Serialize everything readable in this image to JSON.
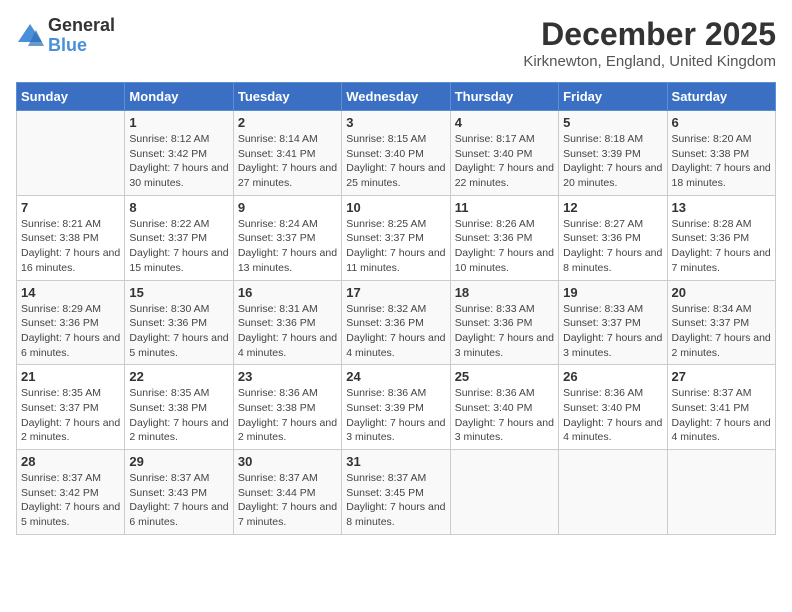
{
  "logo": {
    "general": "General",
    "blue": "Blue"
  },
  "title": "December 2025",
  "location": "Kirknewton, England, United Kingdom",
  "days_of_week": [
    "Sunday",
    "Monday",
    "Tuesday",
    "Wednesday",
    "Thursday",
    "Friday",
    "Saturday"
  ],
  "weeks": [
    [
      {
        "day": "",
        "info": ""
      },
      {
        "day": "1",
        "info": "Sunrise: 8:12 AM\nSunset: 3:42 PM\nDaylight: 7 hours\nand 30 minutes."
      },
      {
        "day": "2",
        "info": "Sunrise: 8:14 AM\nSunset: 3:41 PM\nDaylight: 7 hours\nand 27 minutes."
      },
      {
        "day": "3",
        "info": "Sunrise: 8:15 AM\nSunset: 3:40 PM\nDaylight: 7 hours\nand 25 minutes."
      },
      {
        "day": "4",
        "info": "Sunrise: 8:17 AM\nSunset: 3:40 PM\nDaylight: 7 hours\nand 22 minutes."
      },
      {
        "day": "5",
        "info": "Sunrise: 8:18 AM\nSunset: 3:39 PM\nDaylight: 7 hours\nand 20 minutes."
      },
      {
        "day": "6",
        "info": "Sunrise: 8:20 AM\nSunset: 3:38 PM\nDaylight: 7 hours\nand 18 minutes."
      }
    ],
    [
      {
        "day": "7",
        "info": "Sunrise: 8:21 AM\nSunset: 3:38 PM\nDaylight: 7 hours\nand 16 minutes."
      },
      {
        "day": "8",
        "info": "Sunrise: 8:22 AM\nSunset: 3:37 PM\nDaylight: 7 hours\nand 15 minutes."
      },
      {
        "day": "9",
        "info": "Sunrise: 8:24 AM\nSunset: 3:37 PM\nDaylight: 7 hours\nand 13 minutes."
      },
      {
        "day": "10",
        "info": "Sunrise: 8:25 AM\nSunset: 3:37 PM\nDaylight: 7 hours\nand 11 minutes."
      },
      {
        "day": "11",
        "info": "Sunrise: 8:26 AM\nSunset: 3:36 PM\nDaylight: 7 hours\nand 10 minutes."
      },
      {
        "day": "12",
        "info": "Sunrise: 8:27 AM\nSunset: 3:36 PM\nDaylight: 7 hours\nand 8 minutes."
      },
      {
        "day": "13",
        "info": "Sunrise: 8:28 AM\nSunset: 3:36 PM\nDaylight: 7 hours\nand 7 minutes."
      }
    ],
    [
      {
        "day": "14",
        "info": "Sunrise: 8:29 AM\nSunset: 3:36 PM\nDaylight: 7 hours\nand 6 minutes."
      },
      {
        "day": "15",
        "info": "Sunrise: 8:30 AM\nSunset: 3:36 PM\nDaylight: 7 hours\nand 5 minutes."
      },
      {
        "day": "16",
        "info": "Sunrise: 8:31 AM\nSunset: 3:36 PM\nDaylight: 7 hours\nand 4 minutes."
      },
      {
        "day": "17",
        "info": "Sunrise: 8:32 AM\nSunset: 3:36 PM\nDaylight: 7 hours\nand 4 minutes."
      },
      {
        "day": "18",
        "info": "Sunrise: 8:33 AM\nSunset: 3:36 PM\nDaylight: 7 hours\nand 3 minutes."
      },
      {
        "day": "19",
        "info": "Sunrise: 8:33 AM\nSunset: 3:37 PM\nDaylight: 7 hours\nand 3 minutes."
      },
      {
        "day": "20",
        "info": "Sunrise: 8:34 AM\nSunset: 3:37 PM\nDaylight: 7 hours\nand 2 minutes."
      }
    ],
    [
      {
        "day": "21",
        "info": "Sunrise: 8:35 AM\nSunset: 3:37 PM\nDaylight: 7 hours\nand 2 minutes."
      },
      {
        "day": "22",
        "info": "Sunrise: 8:35 AM\nSunset: 3:38 PM\nDaylight: 7 hours\nand 2 minutes."
      },
      {
        "day": "23",
        "info": "Sunrise: 8:36 AM\nSunset: 3:38 PM\nDaylight: 7 hours\nand 2 minutes."
      },
      {
        "day": "24",
        "info": "Sunrise: 8:36 AM\nSunset: 3:39 PM\nDaylight: 7 hours\nand 3 minutes."
      },
      {
        "day": "25",
        "info": "Sunrise: 8:36 AM\nSunset: 3:40 PM\nDaylight: 7 hours\nand 3 minutes."
      },
      {
        "day": "26",
        "info": "Sunrise: 8:36 AM\nSunset: 3:40 PM\nDaylight: 7 hours\nand 4 minutes."
      },
      {
        "day": "27",
        "info": "Sunrise: 8:37 AM\nSunset: 3:41 PM\nDaylight: 7 hours\nand 4 minutes."
      }
    ],
    [
      {
        "day": "28",
        "info": "Sunrise: 8:37 AM\nSunset: 3:42 PM\nDaylight: 7 hours\nand 5 minutes."
      },
      {
        "day": "29",
        "info": "Sunrise: 8:37 AM\nSunset: 3:43 PM\nDaylight: 7 hours\nand 6 minutes."
      },
      {
        "day": "30",
        "info": "Sunrise: 8:37 AM\nSunset: 3:44 PM\nDaylight: 7 hours\nand 7 minutes."
      },
      {
        "day": "31",
        "info": "Sunrise: 8:37 AM\nSunset: 3:45 PM\nDaylight: 7 hours\nand 8 minutes."
      },
      {
        "day": "",
        "info": ""
      },
      {
        "day": "",
        "info": ""
      },
      {
        "day": "",
        "info": ""
      }
    ]
  ]
}
